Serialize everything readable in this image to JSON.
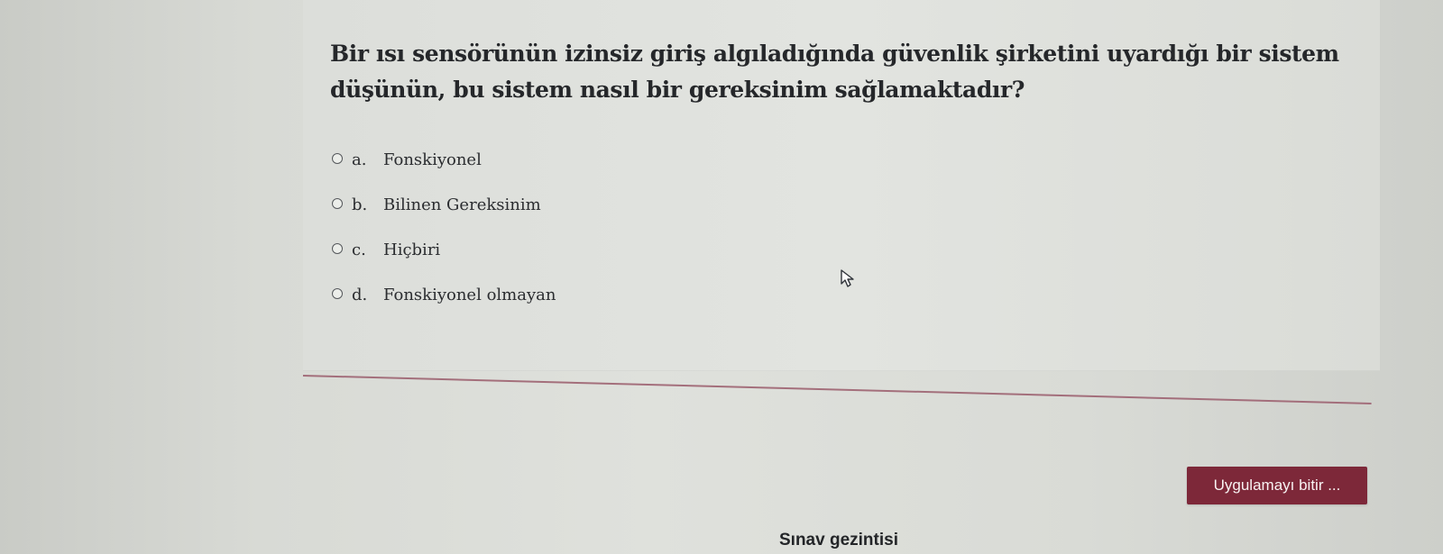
{
  "question": {
    "text": "Bir ısı sensörünün izinsiz giriş algıladığında güvenlik şirketini uyardığı bir sistem düşünün, bu sistem nasıl bir gereksinim sağlamaktadır?",
    "answers": [
      {
        "letter": "a.",
        "text": "Fonskiyonel"
      },
      {
        "letter": "b.",
        "text": "Bilinen Gereksinim"
      },
      {
        "letter": "c.",
        "text": "Hiçbiri"
      },
      {
        "letter": "d.",
        "text": "Fonskiyonel olmayan"
      }
    ]
  },
  "footer": {
    "finish_button_label": "Uygulamayı bitir ...",
    "navigation_title": "Sınav gezintisi"
  },
  "colors": {
    "accent": "#7d2839",
    "separator": "#a06876"
  },
  "icons": {
    "cursor": "mouse-cursor-icon"
  }
}
